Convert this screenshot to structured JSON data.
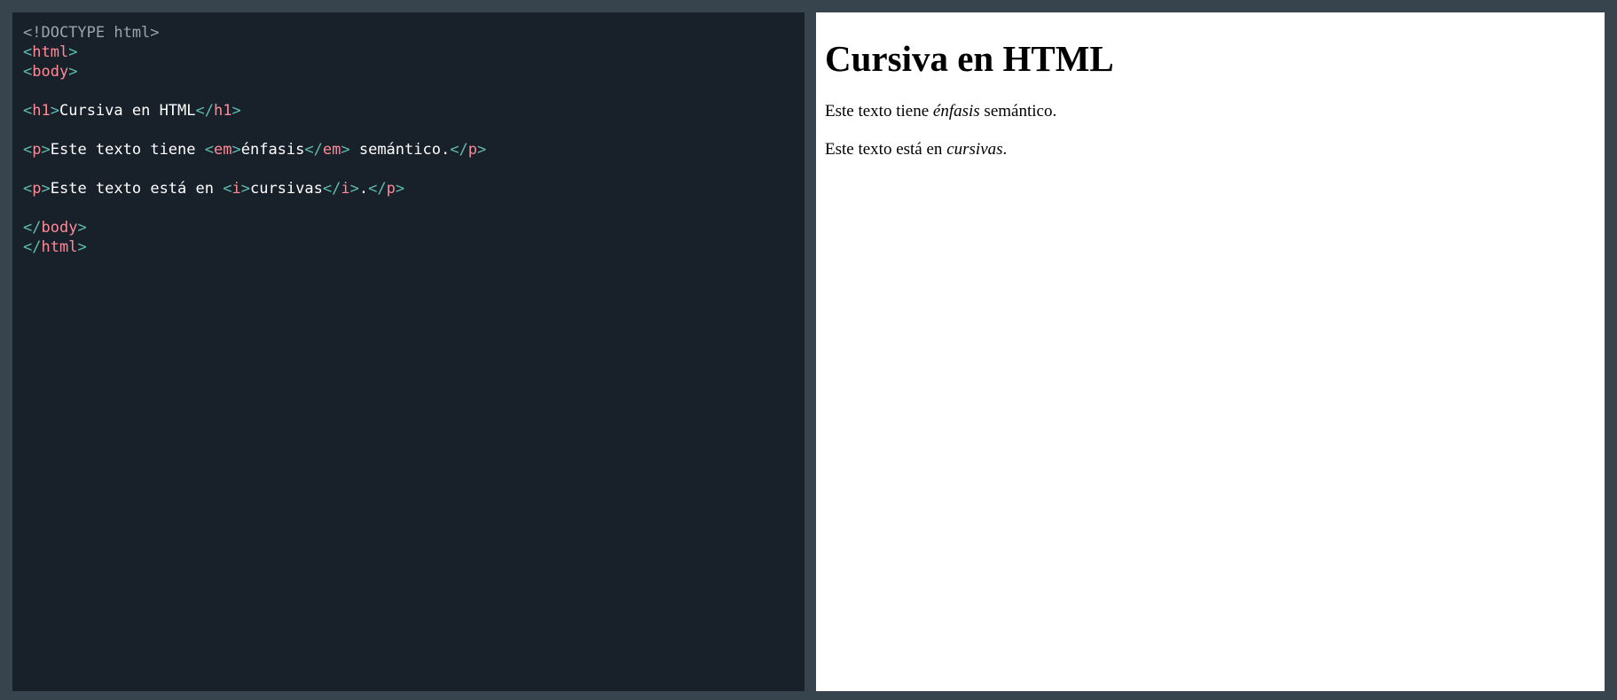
{
  "colors": {
    "frame_background": "#37434d",
    "editor_background": "#18202a",
    "preview_background": "#ffffff",
    "bracket": "#5fbfae",
    "tag": "#ff8a96",
    "doctype": "#9aa4ae",
    "text": "#ffffff"
  },
  "editor": {
    "doctype": "<!DOCTYPE html>",
    "tags": {
      "html": "html",
      "body": "body",
      "h1": "h1",
      "p": "p",
      "em": "em",
      "i": "i"
    },
    "h1_text": "Cursiva en HTML",
    "p1": {
      "before": "Este texto tiene ",
      "em": "énfasis",
      "after": " semántico."
    },
    "p2": {
      "before": "Este texto está en ",
      "i": "cursivas",
      "after": "."
    }
  },
  "preview": {
    "heading": "Cursiva en HTML",
    "p1": {
      "before": "Este texto tiene ",
      "em": "énfasis",
      "after": " semántico."
    },
    "p2": {
      "before": "Este texto está en ",
      "i": "cursivas",
      "after": "."
    }
  }
}
